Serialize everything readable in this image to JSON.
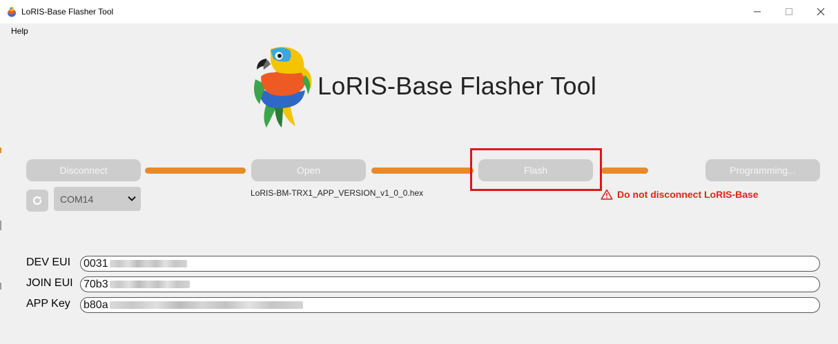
{
  "window": {
    "title": "LoRIS-Base Flasher Tool"
  },
  "menu": {
    "items": [
      "Help"
    ]
  },
  "header": {
    "app_title": "LoRIS-Base Flasher Tool"
  },
  "steps": {
    "disconnect_label": "Disconnect",
    "open_label": "Open",
    "flash_label": "Flash",
    "programming_label": "Programming..."
  },
  "port": {
    "selected": "COM14"
  },
  "hex_file": "LoRIS-BM-TRX1_APP_VERSION_v1_0_0.hex",
  "warning": {
    "text": "Do not disconnect LoRIS-Base"
  },
  "fields": {
    "dev_eui": {
      "label": "DEV EUI",
      "visible_value": "0031"
    },
    "join_eui": {
      "label": "JOIN EUI",
      "visible_value": "70b3"
    },
    "app_key": {
      "label": "APP Key",
      "visible_value": "b80a"
    }
  },
  "colors": {
    "connector": "#e68a2e",
    "button_bg": "#cdcdcd",
    "highlight": "#e3131b",
    "warning": "#e2231a",
    "background": "#f0f0f0"
  },
  "icons": {
    "app": "parrot-icon",
    "refresh": "refresh-icon",
    "dropdown": "chevron-down-icon",
    "warning": "warning-triangle-icon"
  }
}
